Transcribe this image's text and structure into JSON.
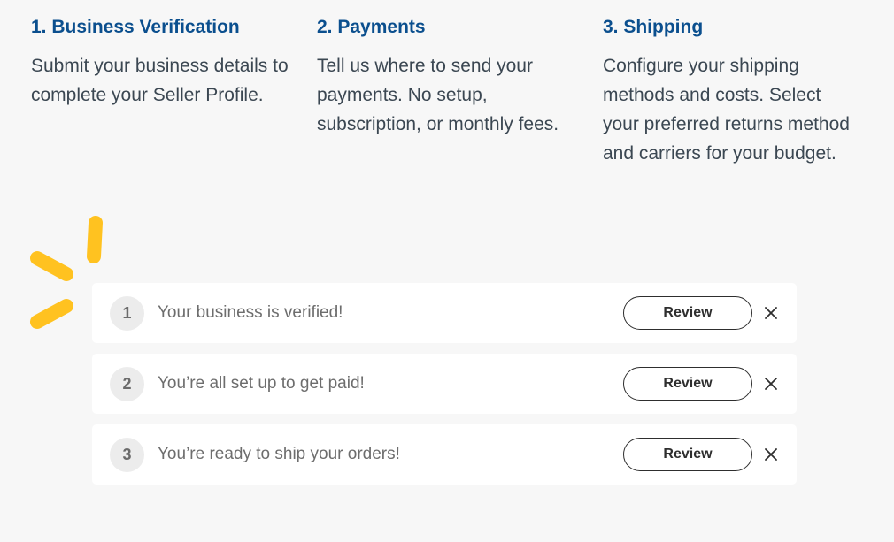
{
  "steps": [
    {
      "title": "1. Business Verification",
      "body": "Submit your business details to complete your Seller Profile."
    },
    {
      "title": "2. Payments",
      "body": "Tell us where to send your payments. No setup, subscription, or monthly fees."
    },
    {
      "title": "3. Shipping",
      "body": "Configure your shipping methods and costs. Select your preferred returns method and carriers for your budget."
    }
  ],
  "status_rows": [
    {
      "number": "1",
      "message": "Your business is verified!",
      "button": "Review"
    },
    {
      "number": "2",
      "message": "You’re all set up to get paid!",
      "button": "Review"
    },
    {
      "number": "3",
      "message": "You’re ready to ship your orders!",
      "button": "Review"
    }
  ],
  "icons": {
    "spark": "spark-logo-icon",
    "close": "close-icon"
  },
  "colors": {
    "heading": "#0b4f8e",
    "body_text": "#3b4752",
    "spark": "#ffc220",
    "background": "#f7f7f7"
  }
}
